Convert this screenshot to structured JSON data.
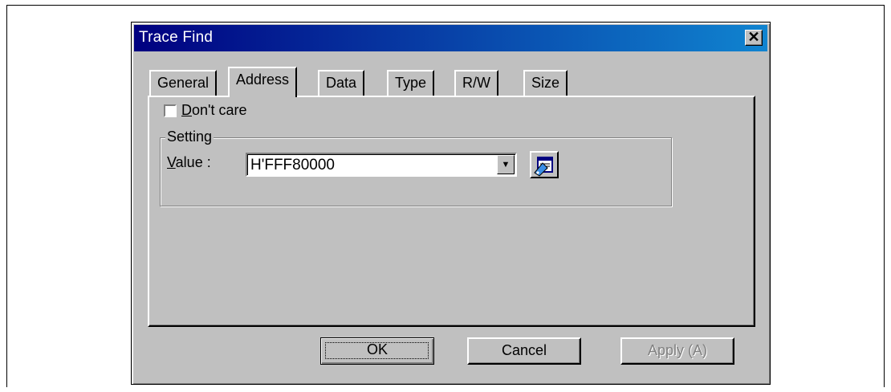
{
  "dialog": {
    "title": "Trace Find",
    "close_symbol": "✕"
  },
  "tabs": [
    {
      "label": "General",
      "active": false
    },
    {
      "label": "Address",
      "active": true
    },
    {
      "label": "Data",
      "active": false
    },
    {
      "label": "Type",
      "active": false
    },
    {
      "label": "R/W",
      "active": false
    },
    {
      "label": "Size",
      "active": false
    }
  ],
  "address": {
    "dont_care_label": "Don't care",
    "dont_care_checked": false,
    "setting_group_label": "Setting",
    "value_label": "Value :",
    "value": "H'FFF80000"
  },
  "buttons": {
    "ok": "OK",
    "cancel": "Cancel",
    "apply": "Apply (A)"
  }
}
